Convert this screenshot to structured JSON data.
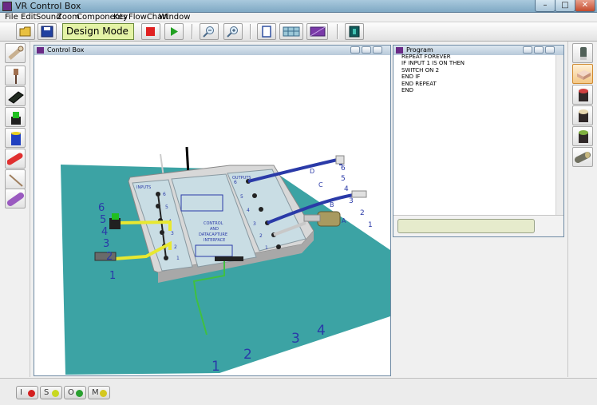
{
  "window": {
    "title": "VR Control Box"
  },
  "menu": [
    "File",
    "Edit",
    "Sound",
    "Zoom",
    "Components",
    "Key",
    "FlowChart",
    "Window"
  ],
  "toolbar": {
    "mode_label": "Design Mode"
  },
  "control_box": {
    "title": "Control Box",
    "labels": {
      "inputs": "INPUTS",
      "outputs": "OUTPUTS",
      "control": "CONTROL",
      "and": "AND",
      "datacapture": "DATACAPTURE",
      "interface": "INTERFACE"
    },
    "pin_numbers_inputs": [
      "6",
      "5",
      "4",
      "3",
      "2",
      "1"
    ],
    "pin_numbers_outputs": [
      "6",
      "5",
      "4",
      "3",
      "2",
      "1"
    ],
    "left_numbers": [
      "6",
      "5",
      "4",
      "3",
      "2",
      "1"
    ],
    "right_numbers": [
      "6",
      "5",
      "4",
      "3",
      "2",
      "1"
    ],
    "bottom_numbers": [
      "1",
      "2",
      "3",
      "4"
    ],
    "letters": [
      "D",
      "C",
      "B",
      "A"
    ]
  },
  "program": {
    "title": "Program",
    "lines": [
      "REPEAT FOREVER",
      "IF INPUT 1 IS ON THEN",
      "SWITCH ON 2",
      "END IF",
      "END REPEAT",
      "END"
    ]
  },
  "status_buttons": [
    {
      "letter": "I",
      "color": "#d42020"
    },
    {
      "letter": "S",
      "color": "#c8d820"
    },
    {
      "letter": "O",
      "color": "#2aa030"
    },
    {
      "letter": "M",
      "color": "#d4c820"
    }
  ],
  "colors": {
    "board": "#3ca3a4",
    "box": "#c8c8c8",
    "panel": "#c9dde4",
    "wire_blue": "#2a3aa8",
    "wire_yellow": "#e8e830",
    "wire_green": "#40c040"
  }
}
